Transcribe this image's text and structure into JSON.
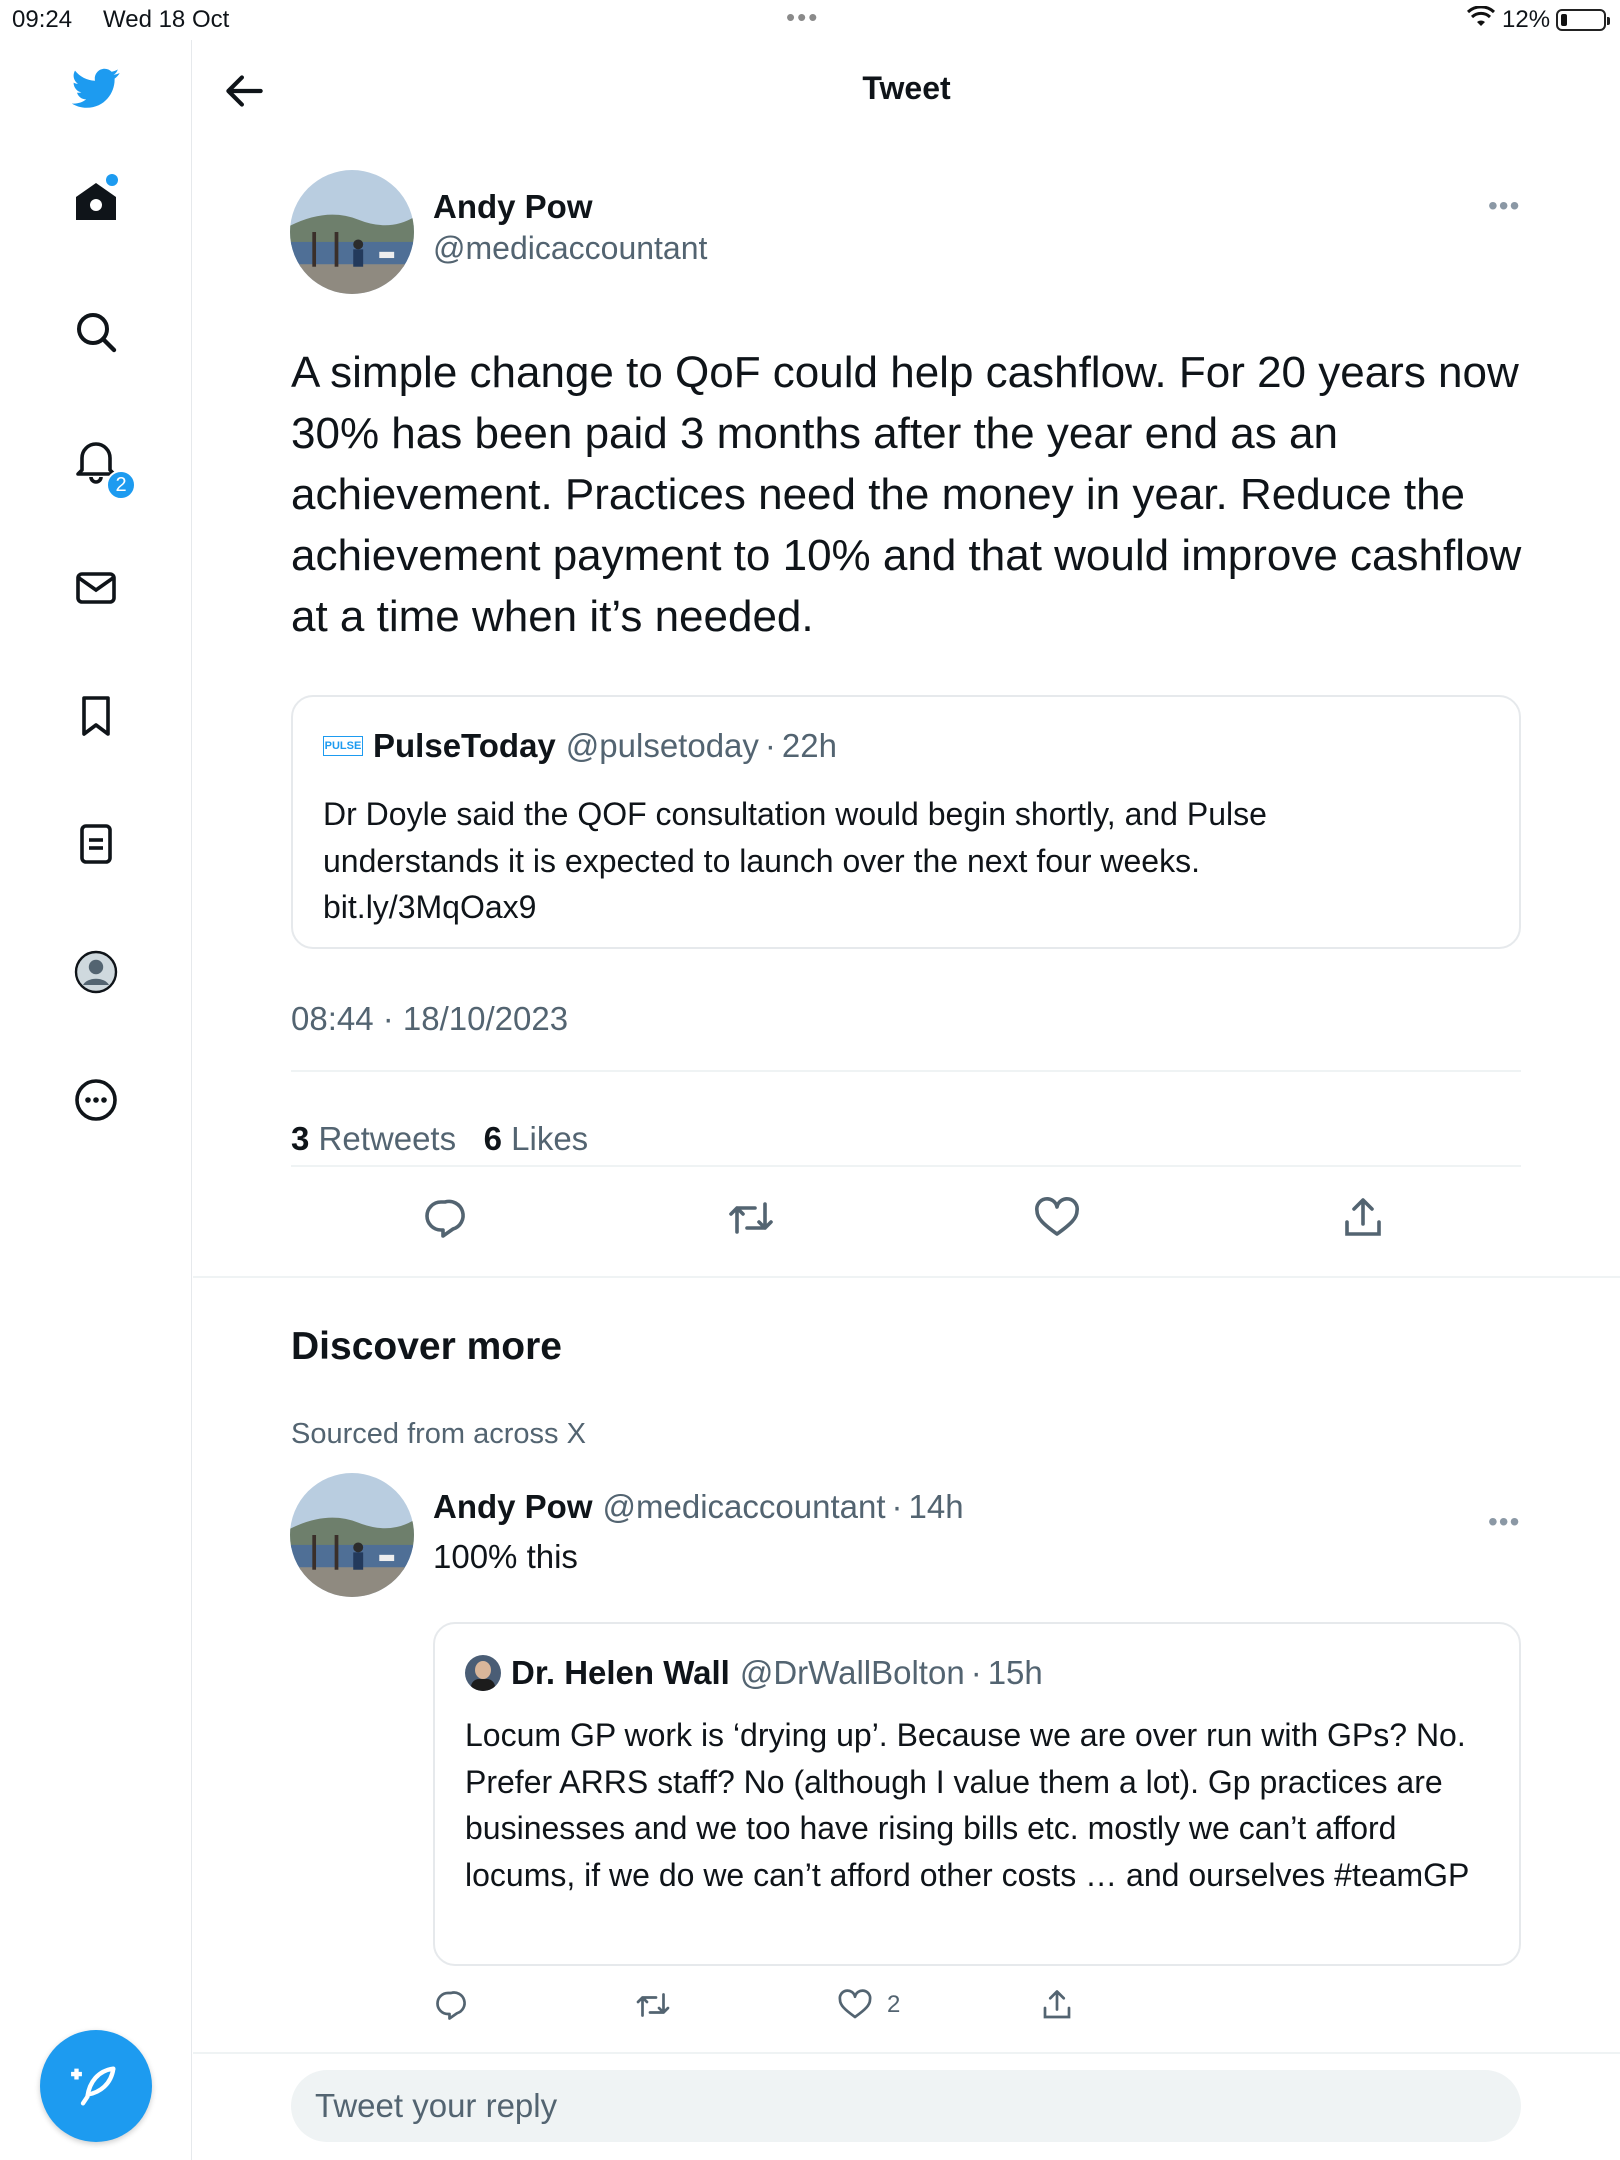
{
  "status_bar": {
    "time": "09:24",
    "date": "Wed 18 Oct",
    "battery": "12%"
  },
  "sidebar": {
    "items": [
      {
        "name": "home",
        "icon": "home-icon"
      },
      {
        "name": "explore",
        "icon": "search-icon"
      },
      {
        "name": "notifications",
        "icon": "bell-icon",
        "badge": "2"
      },
      {
        "name": "messages",
        "icon": "mail-icon"
      },
      {
        "name": "bookmarks",
        "icon": "bookmark-icon"
      },
      {
        "name": "lists",
        "icon": "list-icon"
      },
      {
        "name": "profile",
        "icon": "profile-icon"
      },
      {
        "name": "more",
        "icon": "more-circle-icon"
      }
    ],
    "accent": "#1d9bf0"
  },
  "header": {
    "title": "Tweet"
  },
  "tweet": {
    "author": "Andy Pow",
    "handle": "@medicaccountant",
    "text": "A simple change to QoF could help cashflow. For 20 years now 30% has been paid 3 months after the year end as an achievement. Practices need the money in year. Reduce the achievement payment to 10% and that would improve cashflow at a time when it’s needed.",
    "quote": {
      "logo": "PULSE",
      "name": "PulseToday",
      "handle": "@pulsetoday",
      "age": "22h",
      "text": "Dr Doyle said the QOF consultation would begin shortly, and Pulse understands it is expected to launch over the next four weeks. bit.ly/3MqOax9"
    },
    "timestamp": "08:44 · 18/10/2023",
    "retweets": "3",
    "retweets_label": "Retweets",
    "likes": "6",
    "likes_label": "Likes"
  },
  "discover": {
    "title": "Discover more",
    "subtitle": "Sourced from across X"
  },
  "reply": {
    "author": "Andy Pow",
    "handle": "@medicaccountant",
    "age": "14h",
    "text": "100% this",
    "quote": {
      "name": "Dr. Helen Wall",
      "handle": "@DrWallBolton",
      "age": "15h",
      "text": "Locum GP work is ‘drying up’. Because we are over run with GPs? No. Prefer ARRS staff? No (although I value them a lot). Gp practices are businesses and we too have rising bills etc. mostly we can’t afford locums, if we do we can’t afford other costs … and ourselves #teamGP"
    },
    "like_count": "2"
  },
  "reply_input": {
    "placeholder": "Tweet your reply"
  }
}
